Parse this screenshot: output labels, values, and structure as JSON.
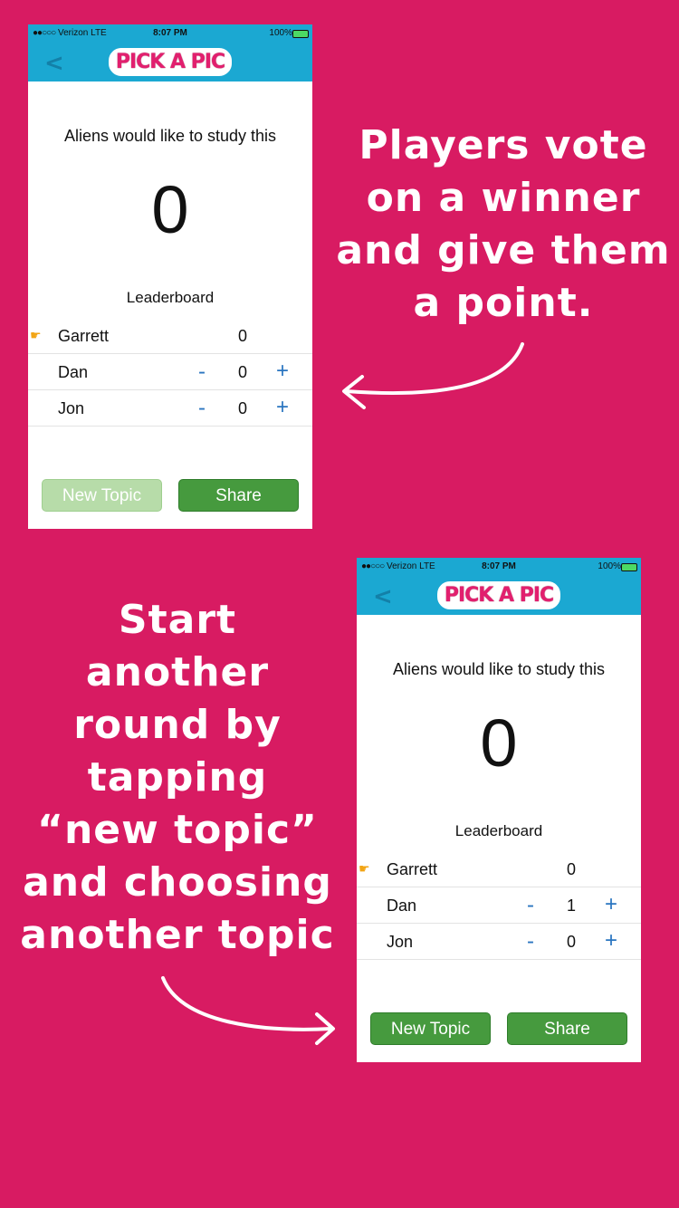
{
  "colors": {
    "background": "#d81b62",
    "navbar": "#1ba8d2",
    "button_green": "#469a3e",
    "button_green_disabled": "#b7dca9",
    "stepper_blue": "#2a75c0"
  },
  "captions": {
    "vote": [
      "Players vote",
      "on a winner",
      "and give them",
      "a point."
    ],
    "new_round": [
      "Start",
      "another",
      "round by",
      "tapping",
      "“new topic”",
      "and choosing",
      "another topic"
    ]
  },
  "screens": [
    {
      "status": {
        "carrier": "Verizon",
        "network": "LTE",
        "time": "8:07 PM",
        "battery": "100%"
      },
      "nav": {
        "back_icon": "chevron-left-icon",
        "logo": "PICK A PIC"
      },
      "topic": "Aliens would like to study this",
      "score": "0",
      "leaderboard_title": "Leaderboard",
      "players": [
        {
          "name": "Garrett",
          "points": "0",
          "judge": true
        },
        {
          "name": "Dan",
          "points": "0",
          "judge": false
        },
        {
          "name": "Jon",
          "points": "0",
          "judge": false
        }
      ],
      "minus": "-",
      "plus": "+",
      "new_topic_label": "New Topic",
      "new_topic_enabled": false,
      "share_label": "Share"
    },
    {
      "status": {
        "carrier": "Verizon",
        "network": "LTE",
        "time": "8:07 PM",
        "battery": "100%"
      },
      "nav": {
        "back_icon": "chevron-left-icon",
        "logo": "PICK A PIC"
      },
      "topic": "Aliens would like to study this",
      "score": "0",
      "leaderboard_title": "Leaderboard",
      "players": [
        {
          "name": "Garrett",
          "points": "0",
          "judge": true
        },
        {
          "name": "Dan",
          "points": "1",
          "judge": false
        },
        {
          "name": "Jon",
          "points": "0",
          "judge": false
        }
      ],
      "minus": "-",
      "plus": "+",
      "new_topic_label": "New Topic",
      "new_topic_enabled": true,
      "share_label": "Share"
    }
  ]
}
